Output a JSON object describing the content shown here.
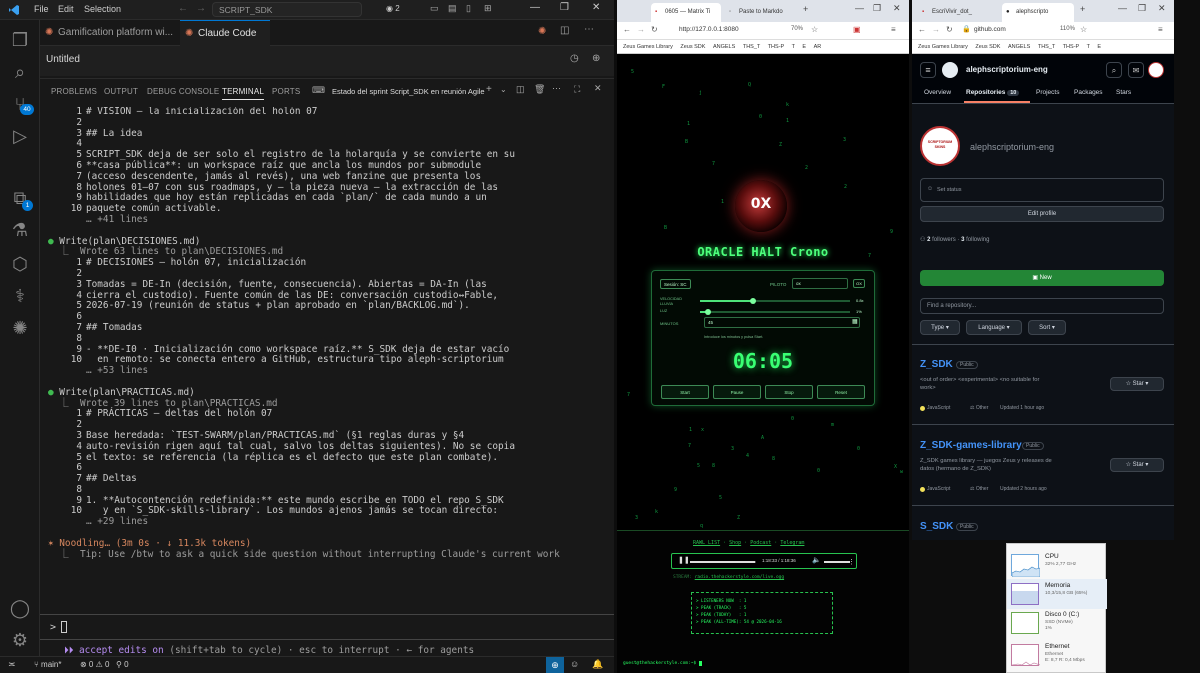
{
  "vscode": {
    "menu": [
      "File",
      "Edit",
      "Selection"
    ],
    "nav_search": "SCRIPT_SDK",
    "account_badge": "2",
    "tabs": [
      {
        "label": "Gamification platform wi..."
      },
      {
        "label": "Claude Code"
      }
    ],
    "editor_title": "Untitled",
    "source_control_badge": "40",
    "extensions_badge": "1",
    "panel_tabs": [
      "PROBLEMS",
      "OUTPUT",
      "DEBUG CONSOLE",
      "TERMINAL",
      "PORTS"
    ],
    "terminal_name": "Estado del sprint Script_SDK en reunión Agile",
    "terminal": [
      {
        "n": "1",
        "t": "# VISIÓN — la inicialización del holón 07"
      },
      {
        "n": "2",
        "t": ""
      },
      {
        "n": "3",
        "t": "## La idea"
      },
      {
        "n": "4",
        "t": ""
      },
      {
        "n": "5",
        "t": "SCRIPT_SDK deja de ser solo el registro de la holarquía y se convierte en su"
      },
      {
        "n": "6",
        "t": "**casa pública**: un workspace raíz que ancla los mundos por submodule"
      },
      {
        "n": "7",
        "t": "(acceso descendente, jamás al revés), una web fanzine que presenta los"
      },
      {
        "n": "8",
        "t": "holones 01–07 con sus roadmaps, y — la pieza nueva — la extracción de las"
      },
      {
        "n": "9",
        "t": "habilidades que hoy están replicadas en cada `plan/` de cada mundo a un"
      },
      {
        "n": "10",
        "t": "paquete común activable."
      },
      {
        "n": "",
        "t": "… +41 lines",
        "cls": "dim"
      },
      {
        "n": "",
        "t": ""
      },
      {
        "n": "",
        "t": "Write(plan\\DECISIONES.md)",
        "cls": "write"
      },
      {
        "n": "",
        "t": "  ⎿  Wrote 63 lines to plan\\DECISIONES.md",
        "cls": "wrote"
      },
      {
        "n": "1",
        "t": "# DECISIONES — holón 07, inicialización"
      },
      {
        "n": "2",
        "t": ""
      },
      {
        "n": "3",
        "t": "Tomadas = DE-In (decisión, fuente, consecuencia). Abiertas = DA-In (las"
      },
      {
        "n": "4",
        "t": "cierra el custodio). Fuente común de las DE: conversación custodio↔Fable,"
      },
      {
        "n": "5",
        "t": "2026-07-19 (reunión de status + plan aprobado en `plan/BACKLOG.md`)."
      },
      {
        "n": "6",
        "t": ""
      },
      {
        "n": "7",
        "t": "## Tomadas"
      },
      {
        "n": "8",
        "t": ""
      },
      {
        "n": "9",
        "t": "- **DE-I0 · Inicialización como workspace raíz.** S_SDK deja de estar vacío"
      },
      {
        "n": "10",
        "t": "  en remoto: se conecta entero a GitHub, estructura tipo aleph-scriptorium"
      },
      {
        "n": "",
        "t": "… +53 lines",
        "cls": "dim"
      },
      {
        "n": "",
        "t": ""
      },
      {
        "n": "",
        "t": "Write(plan\\PRACTICAS.md)",
        "cls": "write"
      },
      {
        "n": "",
        "t": "  ⎿  Wrote 39 lines to plan\\PRACTICAS.md",
        "cls": "wrote"
      },
      {
        "n": "1",
        "t": "# PRÁCTICAS — deltas del holón 07"
      },
      {
        "n": "2",
        "t": ""
      },
      {
        "n": "3",
        "t": "Base heredada: `TEST-SWARM/plan/PRACTICAS.md` (§1 reglas duras y §4"
      },
      {
        "n": "4",
        "t": "auto-revisión rigen aquí tal cual, salvo los deltas siguientes). No se copia"
      },
      {
        "n": "5",
        "t": "el texto: se referencia (la réplica es el defecto que este plan combate)."
      },
      {
        "n": "6",
        "t": ""
      },
      {
        "n": "7",
        "t": "## Deltas"
      },
      {
        "n": "8",
        "t": ""
      },
      {
        "n": "9",
        "t": "1. **Autocontención redefinida:** este mundo escribe en TODO el repo S_SDK"
      },
      {
        "n": "10",
        "t": "   y en `S_SDK-skills-library`. Los mundos ajenos jamás se tocan directo:"
      },
      {
        "n": "",
        "t": "… +29 lines",
        "cls": "dim"
      },
      {
        "n": "",
        "t": ""
      },
      {
        "n": "",
        "t": "✶ Noodling… (3m 0s · ↓ 11.3k tokens)",
        "cls": "noodle"
      },
      {
        "n": "",
        "t": "  ⎿  Tip: Use /btw to ask a quick side question without interrupting Claude's current work",
        "cls": "dim"
      }
    ],
    "prompt_symbol": ">",
    "mode_line": "⏵⏵ accept edits on",
    "mode_hint": "(shift+tab to cycle) · esc to interrupt · ← for agents",
    "status_branch": "main*",
    "status_problems": "⊗ 0 ⚠ 0",
    "status_ports": "0"
  },
  "matrix": {
    "tabs": [
      "0605 — Matrix Ti",
      "Paste to Markdo"
    ],
    "url": "http://127.0.0.1:8080",
    "zoom": "70%",
    "bookmarks": [
      "Zeus Games Library",
      "Zeus SDK",
      "ANGELS",
      "THS_T",
      "THS-P",
      "T",
      "E",
      "AR"
    ],
    "logo": "0X",
    "title": "ORACLE HALT Crono",
    "session_label": "Sesión: SC",
    "piloto_label": "PILOTO",
    "piloto_value": "ox",
    "piloto_btn": "OX",
    "slider_labels": [
      "VELOCIDAD LLUVIA",
      "LUZ"
    ],
    "slider_values": [
      "0.8x",
      "1%"
    ],
    "slider_levels": [
      0.35,
      0.05
    ],
    "minutes_label": "MINUTOS",
    "minutes_value": "45",
    "hint": "Introduce los minutos y pulsa Start.",
    "timer": "06:05",
    "buttons": [
      "Start",
      "Pause",
      "Stop",
      "Reset"
    ],
    "links": [
      "RAWL_LIST",
      "Shop",
      "Podcast",
      "Telegram"
    ],
    "audio_time": "1:18:33 / 1:18:36",
    "audio_progress": 0.99,
    "stream_label": "STREAM:",
    "stream_url": "radio.thehackerstyle.com/live.ogg",
    "listeners": [
      "> LISTENERS NOW  : 1",
      "> PEAK (TRACK)   : 5",
      "> PEAK (TODAY)   : 1",
      "> PEAK (ALL-TIME): 54 @ 2026-04-16"
    ],
    "shell_prompt": "guest@thehackerstyle.com:~$",
    "rain": [
      "0",
      "1",
      "7",
      "x",
      "A",
      "Z",
      "3",
      "k",
      "9",
      "q",
      "4",
      "B",
      "5",
      "7",
      "0",
      "2",
      "Q",
      "Z",
      "8",
      "0",
      "1",
      "5",
      "X",
      "m",
      "7",
      "3",
      "9",
      "k",
      "w",
      "1",
      "2",
      "7",
      "0",
      "B",
      "5",
      "8",
      "F",
      "j",
      "1",
      "3"
    ]
  },
  "github": {
    "tabs": [
      "EscriVivir_dot_",
      "alephscripto"
    ],
    "url": "github.com",
    "zoom": "110%",
    "bookmarks": [
      "Zeus Games Library",
      "Zeus SDK",
      "ANGELS",
      "THS_T",
      "THS-P",
      "T",
      "E"
    ],
    "org": "alephscriptorium-eng",
    "nav": [
      "Overview",
      "Repositories",
      "Projects",
      "Packages",
      "Stars"
    ],
    "repo_count": "10",
    "org_name": "alephscriptorium-eng",
    "avatar_text": "SCRIPTORIUM SKINS",
    "set_status": "Set status",
    "edit_profile": "Edit profile",
    "followers": "2",
    "followers_label": "followers",
    "following": "3",
    "following_label": "following",
    "new_btn": "New",
    "find_placeholder": "Find a repository...",
    "filters": [
      "Type",
      "Language",
      "Sort"
    ],
    "repos": [
      {
        "name": "Z_SDK",
        "visibility": "Public",
        "desc": "<out of order> <experimental> <no suitable for work>",
        "lang": "JavaScript",
        "lang_color": "#f1e05a",
        "license": "Other",
        "updated": "Updated 1 hour ago"
      },
      {
        "name": "Z_SDK-games-library",
        "visibility": "Public",
        "desc": "Z_SDK games library — juegos Zeus y releases de datos (hermano de Z_SDK)",
        "lang": "JavaScript",
        "lang_color": "#f1e05a",
        "license": "Other",
        "updated": "Updated 2 hours ago"
      },
      {
        "name": "S_SDK",
        "visibility": "Public"
      }
    ],
    "star_label": "Star"
  },
  "taskmgr": {
    "items": [
      {
        "name": "CPU",
        "sub": "32% 2,77 GHz"
      },
      {
        "name": "Memoria",
        "sub": "10,3/15,8 GB (65%)"
      },
      {
        "name": "Disco 0 (C:)",
        "sub": "SSD (NVMe)\n1%"
      },
      {
        "name": "Ethernet",
        "sub": "Ethernet\nE: 8,7 R: 0,4 Mbps"
      }
    ]
  },
  "colors": {
    "vscode_bg": "#181818",
    "matrix_green": "#27ff62",
    "github_bg": "#0d1117",
    "github_new": "#238636",
    "github_link": "#4493f8"
  }
}
